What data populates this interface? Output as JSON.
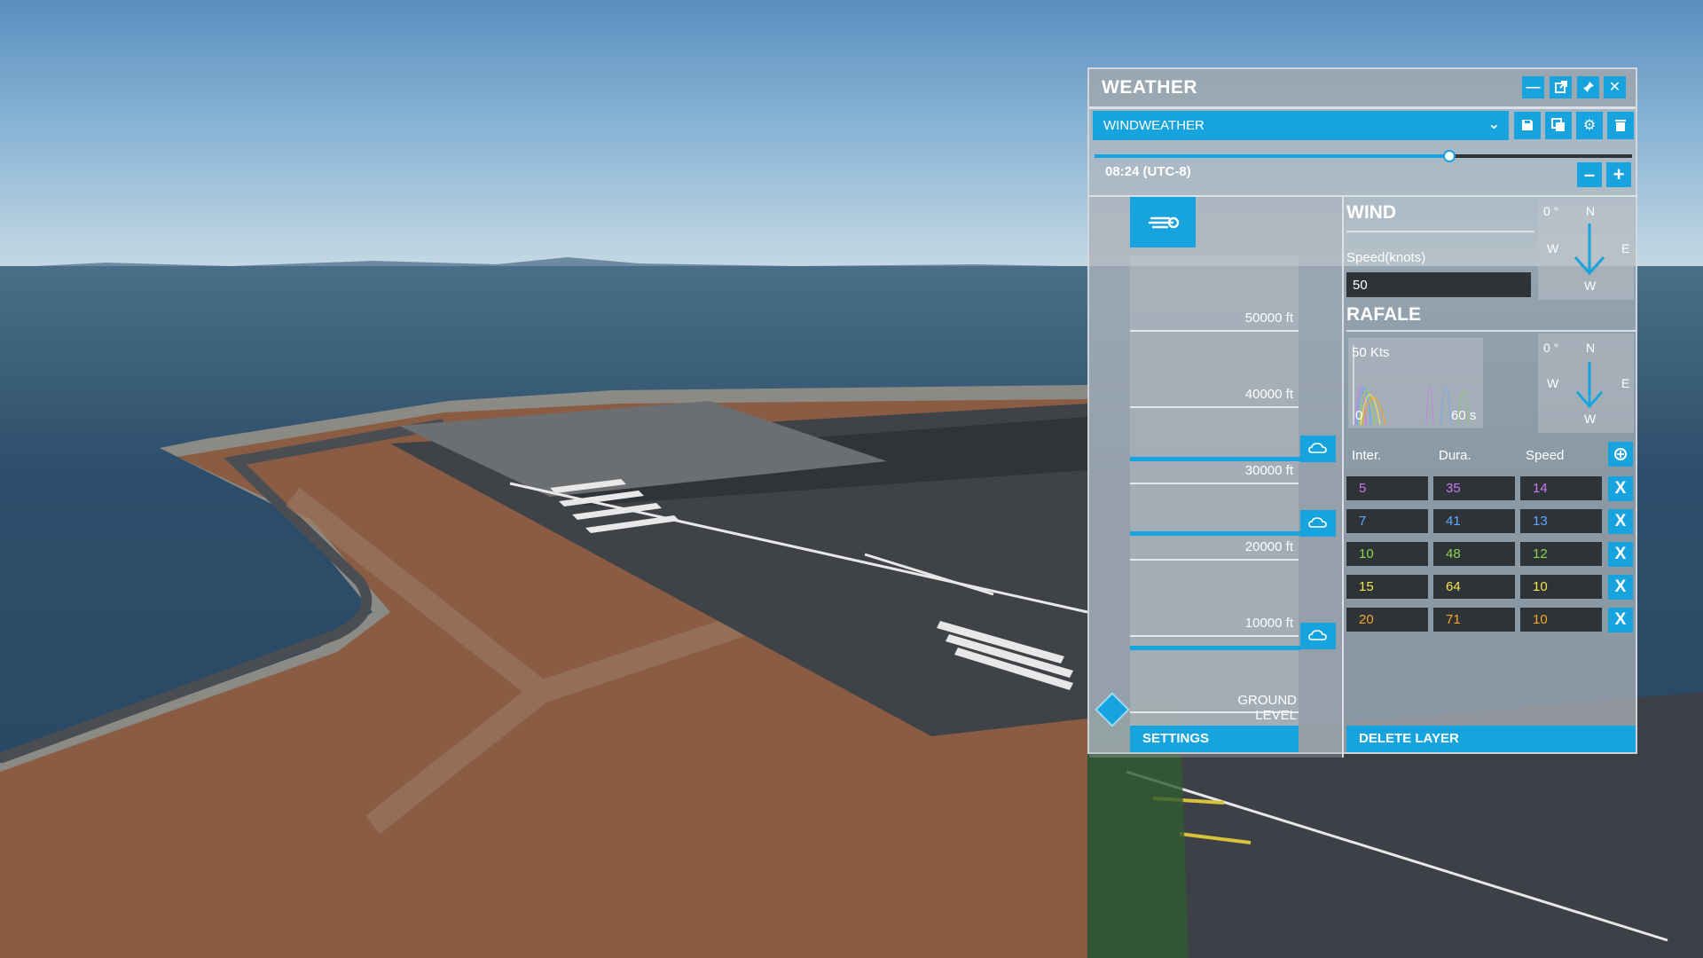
{
  "window": {
    "title": "WEATHER",
    "buttons": [
      "minimize-icon",
      "popout-icon",
      "pin-icon",
      "close-icon"
    ]
  },
  "preset": {
    "selected": "WINDWEATHER",
    "actions": [
      "save-icon",
      "copy-icon",
      "gear-icon",
      "trash-icon"
    ]
  },
  "time": {
    "label": "08:24 (UTC-8)",
    "slider_fraction": 0.66
  },
  "altitude": {
    "levels": [
      "50000 ft",
      "40000 ft",
      "30000 ft",
      "20000 ft",
      "10000 ft"
    ],
    "ground_label": "GROUND LEVEL",
    "settings_label": "SETTINGS"
  },
  "wind": {
    "title": "WIND",
    "speed_label": "Speed(knots)",
    "speed_value": "50",
    "compass": {
      "angle": "0 °",
      "n": "N",
      "w": "W",
      "e": "E",
      "s": "W"
    }
  },
  "rafale": {
    "title": "RAFALE",
    "graph": {
      "top_label": "50 Kts",
      "origin_label": "0",
      "end_label": "60 s"
    },
    "compass": {
      "angle": "0 °",
      "n": "N",
      "w": "W",
      "e": "E",
      "s": "W"
    },
    "columns": [
      "Inter.",
      "Dura.",
      "Speed"
    ],
    "rows": [
      {
        "inter": "5",
        "dura": "35",
        "speed": "14",
        "color": "#c678f0"
      },
      {
        "inter": "7",
        "dura": "41",
        "speed": "13",
        "color": "#5fa8ff"
      },
      {
        "inter": "10",
        "dura": "48",
        "speed": "12",
        "color": "#8fd14f"
      },
      {
        "inter": "15",
        "dura": "64",
        "speed": "10",
        "color": "#f2e44f"
      },
      {
        "inter": "20",
        "dura": "71",
        "speed": "10",
        "color": "#f5a623"
      }
    ],
    "delete_symbol": "X"
  },
  "delete_layer_label": "DELETE LAYER",
  "colors": {
    "accent": "#17a4de",
    "field": "#2e3338"
  }
}
